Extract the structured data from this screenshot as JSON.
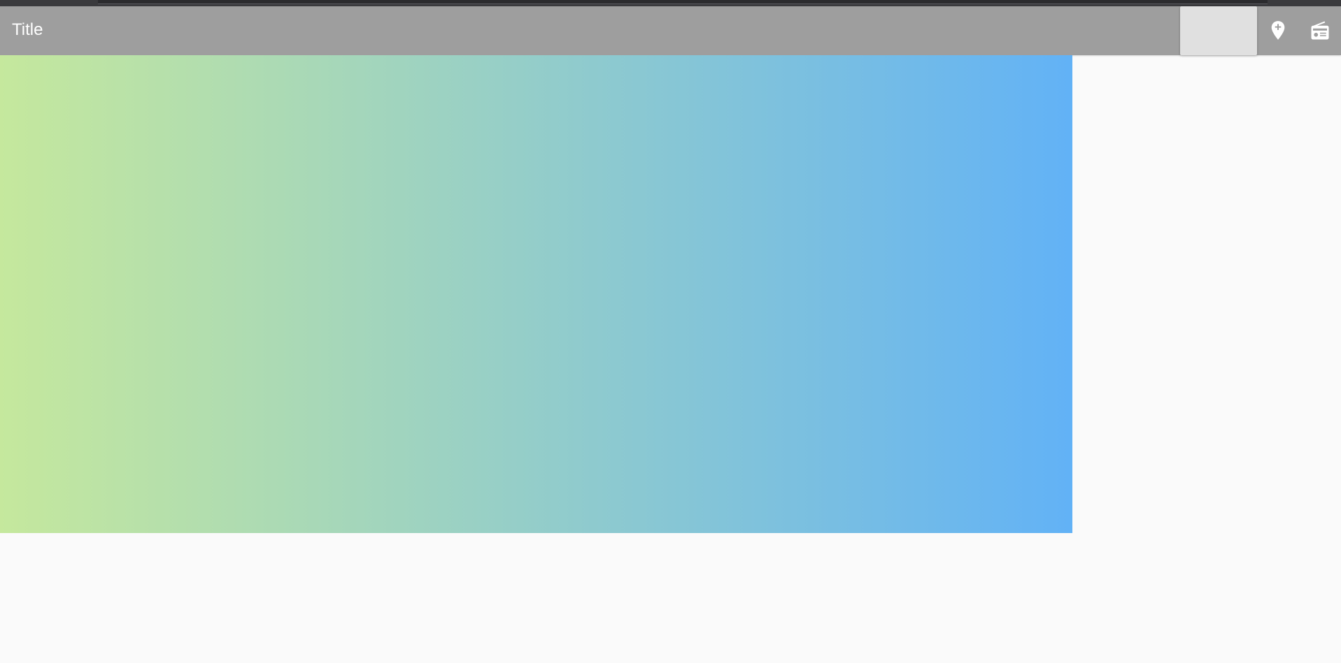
{
  "toolbar": {
    "title": "Title",
    "background_color": "#9e9e9e",
    "actions": [
      {
        "icon": "add-location-icon"
      },
      {
        "icon": "radio-icon"
      }
    ]
  },
  "content": {
    "gradient_start_color": "#c5e89d",
    "gradient_end_color": "#62b2f6"
  },
  "background_color": "#fafafa"
}
